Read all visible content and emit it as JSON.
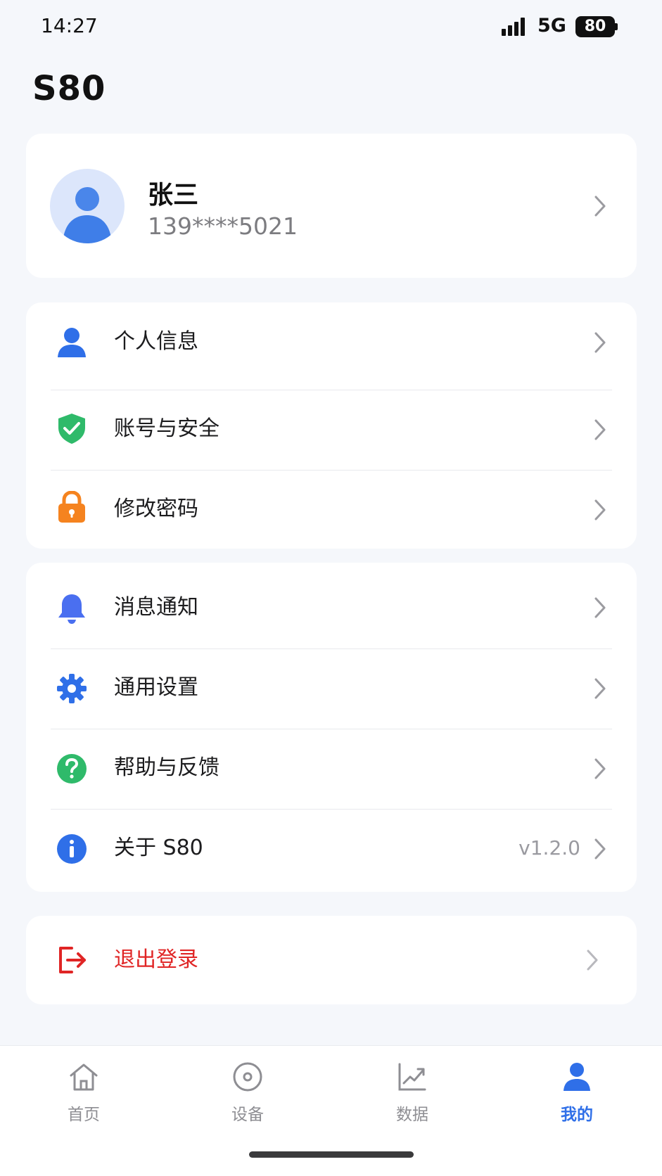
{
  "status_bar": {
    "time": "14:27",
    "network": "5G",
    "battery": "80"
  },
  "page_title": "S80",
  "profile": {
    "name": "张三",
    "phone": "139****5021"
  },
  "menu_group_1": [
    {
      "label": "个人信息",
      "icon": "person-icon"
    },
    {
      "label": "账号与安全",
      "icon": "shield-check-icon"
    },
    {
      "label": "修改密码",
      "icon": "lock-icon"
    }
  ],
  "menu_group_2": [
    {
      "label": "消息通知",
      "icon": "bell-icon"
    },
    {
      "label": "通用设置",
      "icon": "gear-icon"
    },
    {
      "label": "帮助与反馈",
      "icon": "question-icon"
    },
    {
      "label": "关于 S80",
      "icon": "info-icon",
      "value": "v1.2.0"
    }
  ],
  "logout": {
    "label": "退出登录"
  },
  "tabbar": [
    {
      "label": "首页",
      "icon": "home-icon"
    },
    {
      "label": "设备",
      "icon": "device-icon"
    },
    {
      "label": "数据",
      "icon": "chart-icon"
    },
    {
      "label": "我的",
      "icon": "user-icon",
      "active": true
    }
  ],
  "colors": {
    "accent": "#2f6fe8",
    "security": "#2fba6a",
    "lock": "#f5831f",
    "bell": "#4a6ff0",
    "logout": "#e02525",
    "background": "#f5f7fb"
  }
}
